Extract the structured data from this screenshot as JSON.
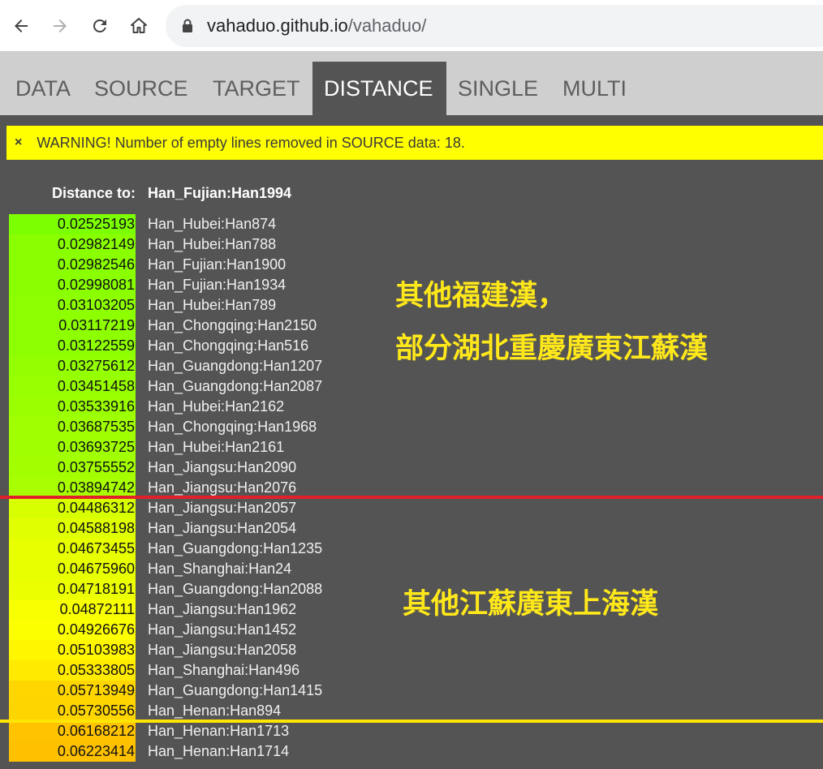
{
  "browser": {
    "url_host": "vahaduo.github.io",
    "url_path": "/vahaduo/"
  },
  "tabs": [
    {
      "label": "DATA",
      "active": false
    },
    {
      "label": "SOURCE",
      "active": false
    },
    {
      "label": "TARGET",
      "active": false
    },
    {
      "label": "DISTANCE",
      "active": true
    },
    {
      "label": "SINGLE",
      "active": false
    },
    {
      "label": "MULTI",
      "active": false
    }
  ],
  "warning": {
    "close": "×",
    "text": "WARNING! Number of empty lines removed in SOURCE data: 18."
  },
  "distance": {
    "label": "Distance to:",
    "target": "Han_Fujian:Han1994",
    "rows": [
      {
        "value": "0.02525193",
        "name": "Han_Hubei:Han874",
        "color": "#7cff00"
      },
      {
        "value": "0.02982149",
        "name": "Han_Hubei:Han788",
        "color": "#8aff00"
      },
      {
        "value": "0.02982546",
        "name": "Han_Fujian:Han1900",
        "color": "#8aff00"
      },
      {
        "value": "0.02998081",
        "name": "Han_Fujian:Han1934",
        "color": "#8aff00"
      },
      {
        "value": "0.03103205",
        "name": "Han_Hubei:Han789",
        "color": "#8eff00"
      },
      {
        "value": "0.03117219",
        "name": "Han_Chongqing:Han2150",
        "color": "#8eff00"
      },
      {
        "value": "0.03122559",
        "name": "Han_Chongqing:Han516",
        "color": "#8eff00"
      },
      {
        "value": "0.03275612",
        "name": "Han_Guangdong:Han1207",
        "color": "#93ff00"
      },
      {
        "value": "0.03451458",
        "name": "Han_Guangdong:Han2087",
        "color": "#98ff00"
      },
      {
        "value": "0.03533916",
        "name": "Han_Hubei:Han2162",
        "color": "#9bff00"
      },
      {
        "value": "0.03687535",
        "name": "Han_Chongqing:Han1968",
        "color": "#a0ff00"
      },
      {
        "value": "0.03693725",
        "name": "Han_Hubei:Han2161",
        "color": "#a0ff00"
      },
      {
        "value": "0.03755552",
        "name": "Han_Jiangsu:Han2090",
        "color": "#a3ff00"
      },
      {
        "value": "0.03894742",
        "name": "Han_Jiangsu:Han2076",
        "color": "#a8ff00"
      },
      {
        "value": "0.04486312",
        "name": "Han_Jiangsu:Han2057",
        "color": "#d8ff00"
      },
      {
        "value": "0.04588198",
        "name": "Han_Jiangsu:Han2054",
        "color": "#e0ff00"
      },
      {
        "value": "0.04673455",
        "name": "Han_Guangdong:Han1235",
        "color": "#e8ff00"
      },
      {
        "value": "0.04675960",
        "name": "Han_Shanghai:Han24",
        "color": "#e8ff00"
      },
      {
        "value": "0.04718191",
        "name": "Han_Guangdong:Han2088",
        "color": "#ecff00"
      },
      {
        "value": "0.04872111",
        "name": "Han_Jiangsu:Han1962",
        "color": "#f8ff00"
      },
      {
        "value": "0.04926676",
        "name": "Han_Jiangsu:Han1452",
        "color": "#fcff00"
      },
      {
        "value": "0.05103983",
        "name": "Han_Jiangsu:Han2058",
        "color": "#fff600"
      },
      {
        "value": "0.05333805",
        "name": "Han_Shanghai:Han496",
        "color": "#ffea00"
      },
      {
        "value": "0.05713949",
        "name": "Han_Guangdong:Han1415",
        "color": "#ffd600"
      },
      {
        "value": "0.05730556",
        "name": "Han_Henan:Han894",
        "color": "#ffd500"
      },
      {
        "value": "0.06168212",
        "name": "Han_Henan:Han1713",
        "color": "#ffc300"
      },
      {
        "value": "0.06223414",
        "name": "Han_Henan:Han1714",
        "color": "#ffc000"
      }
    ]
  },
  "annotations": {
    "line1": "其他福建漢，",
    "line2": "部分湖北重慶廣東江蘇漢",
    "line3": "其他江蘇廣東上海漢"
  }
}
